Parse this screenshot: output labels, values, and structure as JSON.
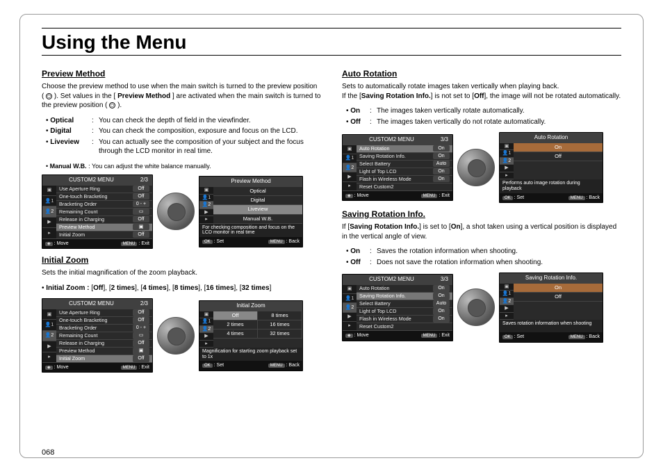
{
  "title": "Using the Menu",
  "pagenum": "068",
  "left": {
    "preview": {
      "heading": "Preview Method",
      "intro": {
        "part1": "Choose the preview method to use when the main switch is turned to the preview position (",
        "part2": "). Set values in the [",
        "bold": "Preview Method",
        "part3": "] are activated when the main switch is turned to the preview position (",
        "part4": ")."
      },
      "items": [
        {
          "label": "Optical",
          "desc": "You can check the depth of field in the viewfinder."
        },
        {
          "label": "Digital",
          "desc": "You can check the composition, exposure and focus on the LCD."
        },
        {
          "label": "Liveview",
          "desc": "You can actually see the composition of your subject and the focus through the LCD monitor in real time."
        }
      ],
      "mwb": {
        "label": "Manual W.B.",
        "desc": "You can adjust the white balance manually."
      },
      "menu": {
        "title": "CUSTOM2 MENU",
        "page": "2/3",
        "rows": [
          {
            "l": "Use Aperture Ring",
            "v": "Off"
          },
          {
            "l": "One-touch Bracketing",
            "v": "Off"
          },
          {
            "l": "Bracketing Order",
            "v": "0 - +"
          },
          {
            "l": "Remaining Count",
            "v": "▭"
          },
          {
            "l": "Release in Charging",
            "v": "Off"
          },
          {
            "l": "Preview Method",
            "v": "▣"
          },
          {
            "l": "Initial Zoom",
            "v": "Off"
          }
        ],
        "foot": {
          "move": ": Move",
          "exit": ": Exit"
        }
      },
      "detail": {
        "title": "Preview Method",
        "opts": [
          "Optical",
          "Digital",
          "Liveview",
          "Manual W.B."
        ],
        "help": "For checking composition and focus on the LCD monitor in real time",
        "foot": {
          "set": ": Set",
          "back": ": Back"
        }
      }
    },
    "zoom": {
      "heading": "Initial Zoom",
      "intro": "Sets the initial magnification of the zoom playback.",
      "opt_label": "Initial Zoom :",
      "opts": [
        "Off",
        "2 times",
        "4 times",
        "8 times",
        "16 times",
        "32 times"
      ],
      "menu": {
        "title": "CUSTOM2 MENU",
        "page": "2/3",
        "rows": [
          {
            "l": "Use Aperture Ring",
            "v": "Off"
          },
          {
            "l": "One-touch Bracketing",
            "v": "Off"
          },
          {
            "l": "Bracketing Order",
            "v": "0 - +"
          },
          {
            "l": "Remaining Count",
            "v": "▭"
          },
          {
            "l": "Release in Charging",
            "v": "Off"
          },
          {
            "l": "Preview Method",
            "v": "▣"
          },
          {
            "l": "Initial Zoom",
            "v": "Off"
          }
        ],
        "foot": {
          "move": ": Move",
          "exit": ": Exit"
        }
      },
      "detail": {
        "title": "Initial Zoom",
        "grid": [
          "Off",
          "8 times",
          "2 times",
          "16 times",
          "4 times",
          "32 times"
        ],
        "help": "Magnification for starting zoom playback set to 1x",
        "foot": {
          "set": ": Set",
          "back": ": Back"
        }
      }
    }
  },
  "right": {
    "auto": {
      "heading": "Auto Rotation",
      "intro": {
        "l1": "Sets to automatically rotate images taken vertically when playing back.",
        "l2a": "If the [",
        "bold": "Saving Rotation Info.",
        "l2b": "] is not set to [",
        "off": "Off",
        "l2c": "], the image will not be rotated automatically."
      },
      "items": [
        {
          "label": "On",
          "desc": "The images taken vertically rotate automatically."
        },
        {
          "label": "Off",
          "desc": "The images taken vertically do not rotate automatically."
        }
      ],
      "menu": {
        "title": "CUSTOM2 MENU",
        "page": "3/3",
        "rows": [
          {
            "l": "Auto Rotation",
            "v": "On"
          },
          {
            "l": "Saving Rotation Info.",
            "v": "On"
          },
          {
            "l": "Select Battery",
            "v": "Auto"
          },
          {
            "l": "Light of Top LCD",
            "v": "On"
          },
          {
            "l": "Flash in Wireless Mode",
            "v": "On"
          },
          {
            "l": "Reset Custom2",
            "v": ""
          }
        ],
        "foot": {
          "move": ": Move",
          "exit": ": Exit"
        }
      },
      "detail": {
        "title": "Auto Rotation",
        "opts": [
          "On",
          "Off"
        ],
        "help": "Performs auto image rotation during playback",
        "foot": {
          "set": ": Set",
          "back": ": Back"
        }
      }
    },
    "save": {
      "heading": "Saving Rotation Info.",
      "intro": {
        "a": "If [",
        "bold": "Saving Rotation Info.",
        "b": "] is set to [",
        "on": "On",
        "c": "], a shot taken using a vertical position is displayed in the vertical angle of view."
      },
      "items": [
        {
          "label": "On",
          "desc": "Saves the rotation information when shooting."
        },
        {
          "label": "Off",
          "desc": "Does not save the rotation information when shooting."
        }
      ],
      "menu": {
        "title": "CUSTOM2 MENU",
        "page": "3/3",
        "rows": [
          {
            "l": "Auto Rotation",
            "v": "On"
          },
          {
            "l": "Saving Rotation Info.",
            "v": "On"
          },
          {
            "l": "Select Battery",
            "v": "Auto"
          },
          {
            "l": "Light of Top LCD",
            "v": "On"
          },
          {
            "l": "Flash in Wireless Mode",
            "v": "On"
          },
          {
            "l": "Reset Custom2",
            "v": ""
          }
        ],
        "foot": {
          "move": ": Move",
          "exit": ": Exit"
        }
      },
      "detail": {
        "title": "Saving Rotation Info.",
        "opts": [
          "On",
          "Off"
        ],
        "help": "Saves rotation information when shooting",
        "foot": {
          "set": ": Set",
          "back": ": Back"
        }
      }
    }
  }
}
